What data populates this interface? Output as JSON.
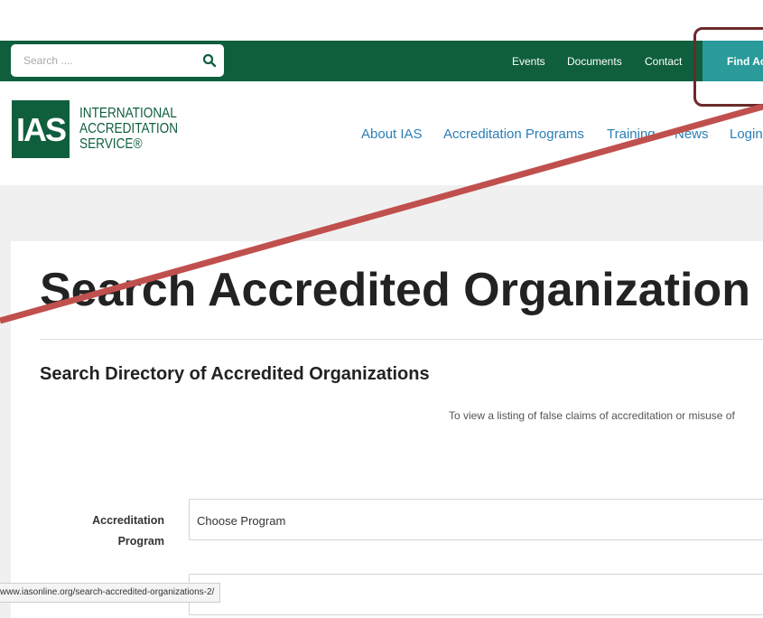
{
  "topbar": {
    "search_placeholder": "Search ....",
    "links": [
      "Events",
      "Documents",
      "Contact"
    ],
    "find_button": "Find Ac"
  },
  "logo": {
    "mark": "IAS",
    "lines": [
      "INTERNATIONAL",
      "ACCREDITATION",
      "SERVICE®"
    ]
  },
  "nav": [
    "About IAS",
    "Accreditation Programs",
    "Training",
    "News",
    "Login"
  ],
  "main": {
    "title": "Search Accredited Organization",
    "subtitle": "Search Directory of Accredited Organizations",
    "note": "To view a listing of false claims of accreditation or misuse of",
    "field_label": "Accreditation Program",
    "select_value": "Choose Program"
  },
  "status_bar": {
    "url": "www.iasonline.org/search-accredited-organizations-2/"
  },
  "colors": {
    "brand_green": "#0f5f3d",
    "teal_button": "#2a9a9a",
    "nav_blue": "#2a7fb5",
    "annotation_red": "#c0504d",
    "callout_border": "#6b2a2a"
  }
}
